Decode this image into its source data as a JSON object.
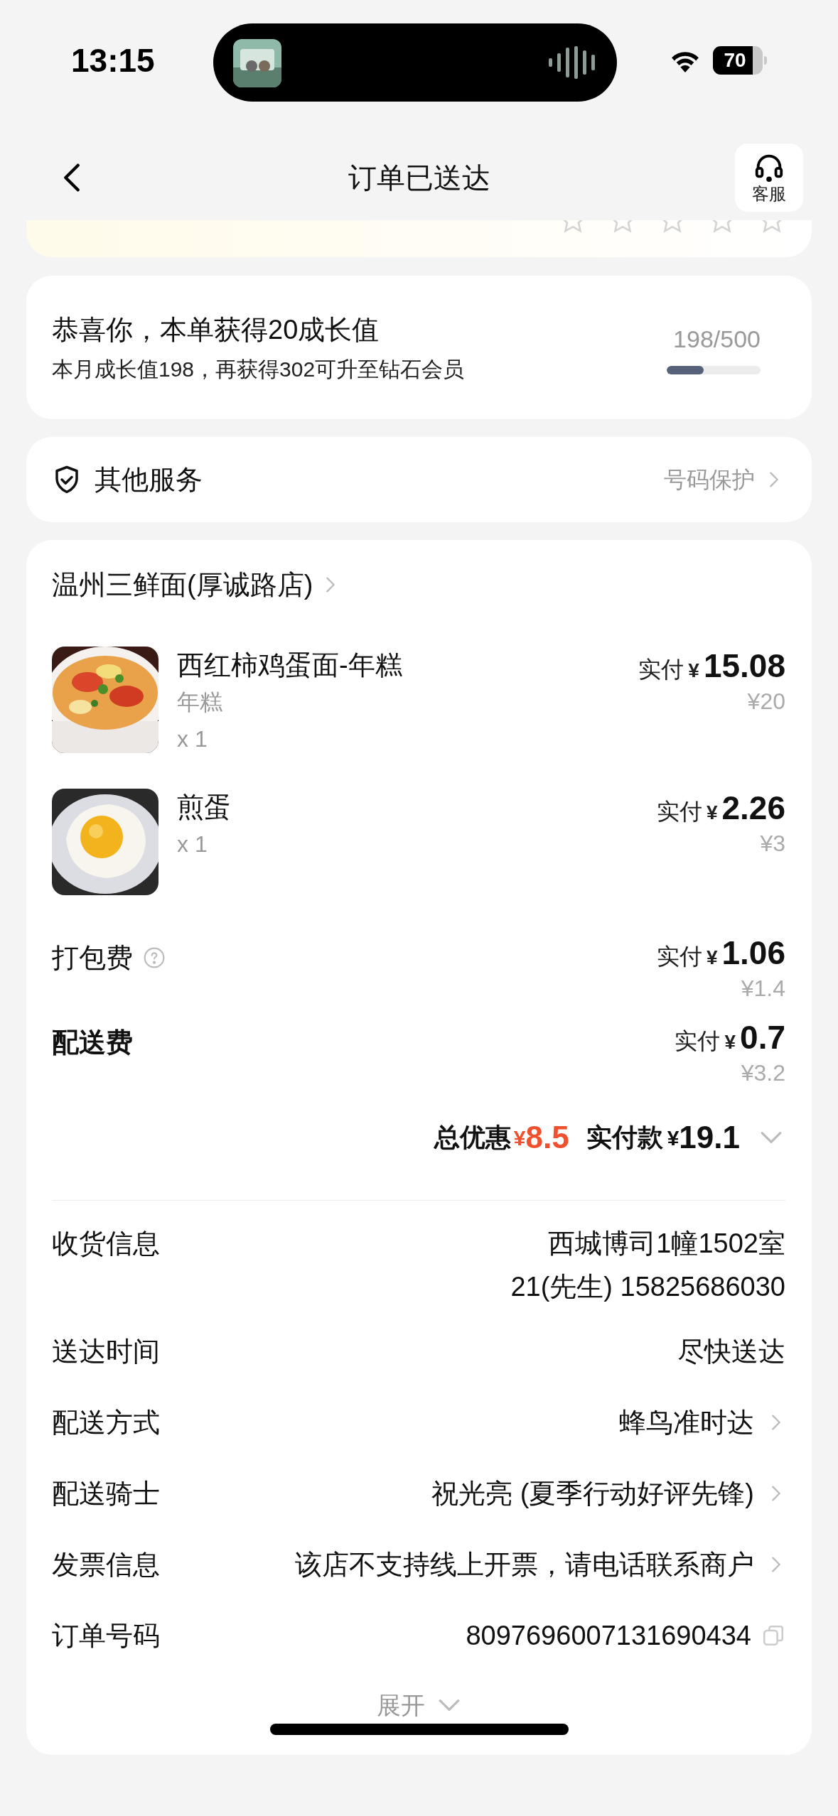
{
  "status_bar": {
    "time": "13:15",
    "battery": "70"
  },
  "header": {
    "title": "订单已送达",
    "service_button": "客服"
  },
  "rating_card": {
    "stars": 0
  },
  "growth_card": {
    "title": "恭喜你，本单获得20成长值",
    "subtitle": "本月成长值198，再获得302可升至钻石会员",
    "progress_text": "198/500",
    "level": 0.396
  },
  "services": {
    "title": "其他服务",
    "link": "号码保护"
  },
  "order": {
    "store": "温州三鲜面(厚诚路店)",
    "items": [
      {
        "name": "西红柿鸡蛋面-年糕",
        "spec": "年糕",
        "quantity": "x 1",
        "paid_label": "实付",
        "currency": "¥",
        "paid": "15.08",
        "original": "¥20",
        "kind": "noodles"
      },
      {
        "name": "煎蛋",
        "quantity": "x 1",
        "paid_label": "实付",
        "currency": "¥",
        "paid": "2.26",
        "original": "¥3",
        "kind": "egg"
      }
    ],
    "fees": [
      {
        "label": "打包费",
        "help": true,
        "bold": false,
        "paid_label": "实付",
        "currency": "¥",
        "paid": "1.06",
        "original": "¥1.4"
      },
      {
        "label": "配送费",
        "help": false,
        "bold": true,
        "paid_label": "实付",
        "currency": "¥",
        "paid": "0.7",
        "original": "¥3.2"
      }
    ],
    "summary": {
      "discount_label": "总优惠",
      "discount_currency": "¥",
      "discount": "8.5",
      "total_label": "实付款",
      "currency": "¥",
      "total": "19.1"
    },
    "info": [
      {
        "label": "收货信息",
        "lines": [
          "西城博司1幢1502室",
          "21(先生) 15825686030"
        ],
        "kind": "plain"
      },
      {
        "label": "送达时间",
        "lines": [
          "尽快送达"
        ],
        "kind": "plain"
      },
      {
        "label": "配送方式",
        "lines": [
          "蜂鸟准时达"
        ],
        "kind": "link"
      },
      {
        "label": "配送骑士",
        "lines": [
          "祝光亮 (夏季行动好评先锋)"
        ],
        "kind": "link"
      },
      {
        "label": "发票信息",
        "lines": [
          "该店不支持线上开票，请电话联系商户"
        ],
        "kind": "link"
      },
      {
        "label": "订单号码",
        "lines": [
          "8097696007131690434"
        ],
        "kind": "copy"
      }
    ],
    "expand": "展开"
  }
}
